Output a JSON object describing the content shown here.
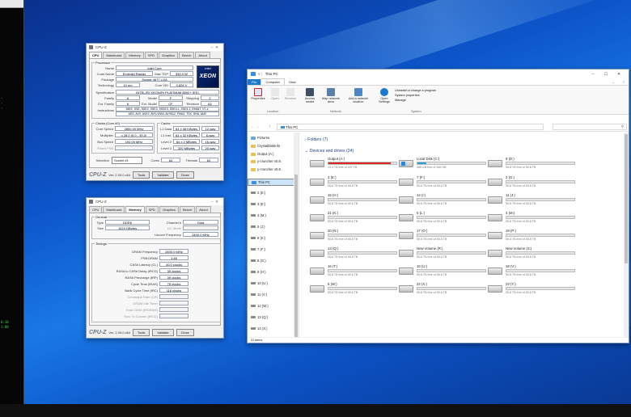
{
  "cpuz1": {
    "title": "CPU-Z",
    "tabs": [
      "CPU",
      "Mainboard",
      "Memory",
      "SPD",
      "Graphics",
      "Bench",
      "About"
    ],
    "processor": {
      "group": "Processor",
      "rows": [
        {
          "label": "Name",
          "value": "Intel Core"
        },
        {
          "label": "Code Name",
          "value": "Emerald Rapids"
        },
        {
          "label": "Package",
          "value": "Socket 4677 LGA"
        },
        {
          "label": "Technology",
          "value": "10 nm"
        },
        {
          "label": "Specification",
          "value": "INTEL(R) XEON(R) PLATINUM 8592+ (ES)"
        },
        {
          "label": "Family",
          "value": "6"
        },
        {
          "label": "Ext. Family",
          "value": "6"
        },
        {
          "label": "Instructions",
          "value": "MMX, SSE, SSE2, SSE3, SSSE3, SSE4.1, SSE4.2, EM64T, VT-x,"
        },
        {
          "label": "",
          "value": "AES, AVX, AVX2, AVX-VNNI, AVX512, FMA3, TSX, SHA, AMX"
        }
      ],
      "max_tdp_label": "Max TDP",
      "max_tdp": "350.0 W",
      "core_vid_label": "Core VID",
      "core_vid": "0.828 V",
      "model_label": "Model",
      "model": "F",
      "ext_model_label": "Ext. Model",
      "ext_model": "CF",
      "stepping_label": "Stepping",
      "stepping": "2",
      "revision_label": "Revision",
      "revision": "A1",
      "logo_small": "intel",
      "logo_big": "XEON"
    },
    "clocks": {
      "group": "Clocks (Core #0)",
      "rows": [
        {
          "label": "Core Speed",
          "value": "2800.00 MHz"
        },
        {
          "label": "Multiplier",
          "value": "x 28.0 (5.0 - 39.0)"
        },
        {
          "label": "Bus Speed",
          "value": "100.00 MHz"
        },
        {
          "label": "Rated FSB",
          "value": ""
        }
      ]
    },
    "cache": {
      "group": "Cache",
      "rows": [
        {
          "label": "L1 Data",
          "value": "64 x 48 KBytes",
          "way": "12-way"
        },
        {
          "label": "L1 Inst.",
          "value": "64 x 32 KBytes",
          "way": "8-way"
        },
        {
          "label": "Level 2",
          "value": "64 x 2 MBytes",
          "way": "16-way"
        },
        {
          "label": "Level 3",
          "value": "320 MBytes",
          "way": "20-way"
        }
      ]
    },
    "selection_label": "Selection",
    "selection": "Socket #1",
    "cores_label": "Cores",
    "cores": "64",
    "threads_label": "Threads",
    "threads": "64",
    "footer": {
      "logo": "CPU-Z",
      "version": "Ver. 2.09.0.x64",
      "tools": "Tools",
      "validate": "Validate",
      "close": "Close"
    }
  },
  "cpuz2": {
    "title": "CPU-Z",
    "tabs": [
      "CPU",
      "Mainboard",
      "Memory",
      "SPD",
      "Graphics",
      "Bench",
      "About"
    ],
    "general": {
      "group": "General",
      "type_label": "Type",
      "type": "DDR5",
      "size_label": "Size",
      "size": "1024 GBytes",
      "channel_label": "Channel #",
      "channel": "Octa",
      "dcmode_label": "DC Mode",
      "dcmode": "",
      "uncore_label": "Uncore Frequency",
      "uncore": "2400.0 MHz"
    },
    "timings": {
      "group": "Timings",
      "rows": [
        {
          "label": "DRAM Frequency",
          "value": "2400.0 MHz"
        },
        {
          "label": "FSB:DRAM",
          "value": "1:48"
        },
        {
          "label": "CAS# Latency (CL)",
          "value": "40.0 clocks"
        },
        {
          "label": "RAS# to CAS# Delay (tRCD)",
          "value": "39 clocks"
        },
        {
          "label": "RAS# Precharge (tRP)",
          "value": "39 clocks"
        },
        {
          "label": "Cycle Time (tRAS)",
          "value": "78 clocks"
        },
        {
          "label": "Bank Cycle Time (tRC)",
          "value": "116 clocks"
        },
        {
          "label": "Command Rate (CR)",
          "value": ""
        },
        {
          "label": "DRAM Idle Timer",
          "value": ""
        },
        {
          "label": "Total CAS# (tRDRAM)",
          "value": ""
        },
        {
          "label": "Row To Column (tRCD)",
          "value": ""
        }
      ]
    },
    "footer": {
      "logo": "CPU-Z",
      "version": "Ver. 2.09.0.x64",
      "tools": "Tools",
      "validate": "Validate",
      "close": "Close"
    }
  },
  "explorer": {
    "title": "This PC",
    "ribbon_tabs": [
      "File",
      "Computer",
      "View"
    ],
    "ribbon_buttons": [
      {
        "label": "Properties"
      },
      {
        "label": "Open"
      },
      {
        "label": "Rename"
      },
      {
        "label": "Access media"
      },
      {
        "label": "Map network drive"
      },
      {
        "label": "Add a network location"
      },
      {
        "label": "Open Settings"
      }
    ],
    "system_items": [
      "Uninstall or change a program",
      "System properties",
      "Manage"
    ],
    "group_labels": [
      "Location",
      "Network",
      "System"
    ],
    "address": "This PC",
    "nav": [
      {
        "label": "Pictures",
        "kind": "pic"
      },
      {
        "label": "CrystalDiskInfo",
        "kind": "f"
      },
      {
        "label": "Output (A:)",
        "kind": "f"
      },
      {
        "label": "y-cruncher v0.8.",
        "kind": "f"
      },
      {
        "label": "y-cruncher v0.8.",
        "kind": "f"
      },
      {
        "label": "This PC",
        "kind": "pc"
      },
      {
        "label": "2 (E:)",
        "kind": "dr"
      },
      {
        "label": "3 (E:)",
        "kind": "dr"
      },
      {
        "label": "4 (M:)",
        "kind": "dr"
      },
      {
        "label": "5 (J:)",
        "kind": "dr"
      },
      {
        "label": "6 (K:)",
        "kind": "dr"
      },
      {
        "label": "7 (F:)",
        "kind": "dr"
      },
      {
        "label": "8 (G:)",
        "kind": "dr"
      },
      {
        "label": "9 (H:)",
        "kind": "dr"
      },
      {
        "label": "10 (U:)",
        "kind": "dr"
      },
      {
        "label": "11 (V:)",
        "kind": "dr"
      },
      {
        "label": "12 (W:)",
        "kind": "dr"
      },
      {
        "label": "13 (Q:)",
        "kind": "dr"
      },
      {
        "label": "14 (X:)",
        "kind": "dr"
      },
      {
        "label": "16 (T:)",
        "kind": "dr"
      }
    ],
    "folders_header": "Folders (7)",
    "devices_header": "Devices and drives (24)",
    "drives": [
      {
        "name": "Output (A:)",
        "free": "13.4 TB free of 167 TB",
        "used": 0.92,
        "sys": false
      },
      {
        "name": "Local Disk (C:)",
        "free": "388 GB free of 446 GB",
        "used": 0.13,
        "sys": true
      },
      {
        "name": "9 (D:)",
        "free": "55.8 TB free of 55.8 TB",
        "used": 0.0,
        "sys": false
      },
      {
        "name": "3 (E:)",
        "free": "55.8 TB free of 55.8 TB",
        "used": 0.0,
        "sys": false
      },
      {
        "name": "7 (F:)",
        "free": "55.8 TB free of 55.8 TB",
        "used": 0.0,
        "sys": false
      },
      {
        "name": "2 (G:)",
        "free": "55.8 TB free of 55.8 TB",
        "used": 0.0,
        "sys": false
      },
      {
        "name": "15 (H:)",
        "free": "55.8 TB free of 55.8 TB",
        "used": 0.0,
        "sys": false
      },
      {
        "name": "14 (I:)",
        "free": "55.8 TB free of 55.8 TB",
        "used": 0.0,
        "sys": false
      },
      {
        "name": "11 (J:)",
        "free": "55.8 TB free of 55.8 TB",
        "used": 0.0,
        "sys": false
      },
      {
        "name": "21 (K:)",
        "free": "55.8 TB free of 55.8 TB",
        "used": 0.0,
        "sys": false
      },
      {
        "name": "5 (L:)",
        "free": "55.8 TB free of 55.8 TB",
        "used": 0.0,
        "sys": false
      },
      {
        "name": "4 (M:)",
        "free": "55.8 TB free of 55.8 TB",
        "used": 0.0,
        "sys": false
      },
      {
        "name": "20 (N:)",
        "free": "55.8 TB free of 55.8 TB",
        "used": 0.0,
        "sys": false
      },
      {
        "name": "17 (O:)",
        "free": "55.8 TB free of 55.8 TB",
        "used": 0.0,
        "sys": false
      },
      {
        "name": "19 (P:)",
        "free": "55.8 TB free of 55.8 TB",
        "used": 0.0,
        "sys": false
      },
      {
        "name": "13 (Q:)",
        "free": "55.8 TB free of 55.8 TB",
        "used": 0.0,
        "sys": false
      },
      {
        "name": "New Volume (R:)",
        "free": "55.8 TB free of 55.8 TB",
        "used": 0.0,
        "sys": false
      },
      {
        "name": "New Volume (S:)",
        "free": "55.8 TB free of 55.8 TB",
        "used": 0.0,
        "sys": false
      },
      {
        "name": "16 (T:)",
        "free": "55.8 TB free of 55.8 TB",
        "used": 0.0,
        "sys": false
      },
      {
        "name": "10 (U:)",
        "free": "55.8 TB free of 55.8 TB",
        "used": 0.0,
        "sys": false
      },
      {
        "name": "18 (V:)",
        "free": "55.8 TB free of 55.8 TB",
        "used": 0.0,
        "sys": false
      },
      {
        "name": "6 (W:)",
        "free": "55.8 TB free of 55.8 TB",
        "used": 0.0,
        "sys": false
      },
      {
        "name": "22 (X:)",
        "free": "55.8 TB free of 55.8 TB",
        "used": 0.0,
        "sys": false
      },
      {
        "name": "23 (Y:)",
        "free": "55.8 TB free of 55.8 TB",
        "used": 0.0,
        "sys": false
      }
    ],
    "status": "31 items"
  },
  "console": {
    "lines": [
      ".",
      ".",
      ".",
      "0:10",
      "1:00"
    ]
  },
  "colors": {
    "accent": "#1979ca",
    "bar_blue": "#26a0da",
    "bar_red": "#da2626",
    "desktop": "#0c55c9"
  }
}
